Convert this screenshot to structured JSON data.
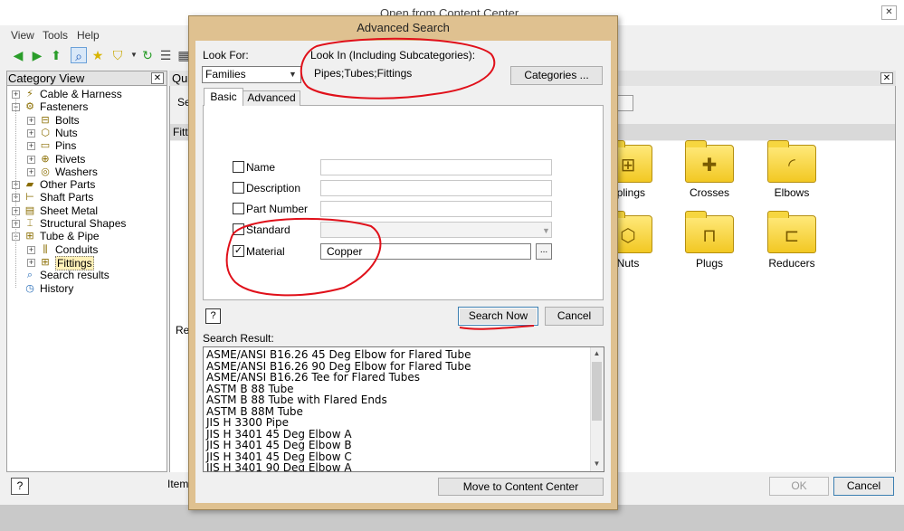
{
  "background_window": {
    "title": "Open from Content Center",
    "close_glyph": "✕",
    "menu": [
      "View",
      "Tools",
      "Help"
    ]
  },
  "category_view": {
    "title": "Category View",
    "close_glyph": "✕",
    "tree": [
      {
        "label": "Cable & Harness",
        "icon": "cable-icon",
        "expand": "+"
      },
      {
        "label": "Fasteners",
        "icon": "fastener-icon",
        "expand": "−"
      },
      {
        "label": "Bolts",
        "icon": "bolt-icon",
        "expand": "+"
      },
      {
        "label": "Nuts",
        "icon": "nut-icon",
        "expand": "+"
      },
      {
        "label": "Pins",
        "icon": "pin-icon",
        "expand": "+"
      },
      {
        "label": "Rivets",
        "icon": "rivet-icon",
        "expand": "+"
      },
      {
        "label": "Washers",
        "icon": "washer-icon",
        "expand": "+"
      },
      {
        "label": "Other Parts",
        "icon": "folder-icon",
        "expand": "+"
      },
      {
        "label": "Shaft Parts",
        "icon": "shaft-icon",
        "expand": "+"
      },
      {
        "label": "Sheet Metal",
        "icon": "sheet-metal-icon",
        "expand": "+"
      },
      {
        "label": "Structural Shapes",
        "icon": "beam-icon",
        "expand": "+"
      },
      {
        "label": "Tube & Pipe",
        "icon": "pipe-icon",
        "expand": "−"
      },
      {
        "label": "Conduits",
        "icon": "conduit-icon",
        "expand": "+"
      },
      {
        "label": "Fittings",
        "icon": "fitting-icon",
        "expand": "+"
      },
      {
        "label": "Search results",
        "icon": "search-icon",
        "expand": ""
      },
      {
        "label": "History",
        "icon": "history-icon",
        "expand": ""
      }
    ]
  },
  "quick_panel": {
    "title": "Qui",
    "search_prefix": "Se",
    "section_label": "Fitt",
    "close_glyph": "✕",
    "items": [
      {
        "label": "uplings",
        "icon": "coupling-icon"
      },
      {
        "label": "Crosses",
        "icon": "cross-icon"
      },
      {
        "label": "Elbows",
        "icon": "elbow-icon"
      },
      {
        "label": "Nuts",
        "icon": "nut-icon"
      },
      {
        "label": "Plugs",
        "icon": "plug-icon"
      },
      {
        "label": "Reducers",
        "icon": "reducer-icon"
      }
    ],
    "re_label": "Re"
  },
  "bottom": {
    "help": "?",
    "item_label": "Item",
    "ok": "OK",
    "cancel": "Cancel"
  },
  "dialog": {
    "title": "Advanced Search",
    "look_for_label": "Look For:",
    "look_for_value": "Families",
    "look_in_label": "Look In (Including Subcategories):",
    "look_in_value": "Pipes;Tubes;Fittings",
    "categories_button": "Categories ...",
    "tabs": [
      "Basic",
      "Advanced"
    ],
    "criteria": [
      {
        "label": "Name",
        "checked": false,
        "value": ""
      },
      {
        "label": "Description",
        "checked": false,
        "value": ""
      },
      {
        "label": "Part Number",
        "checked": false,
        "value": ""
      },
      {
        "label": "Standard",
        "checked": false,
        "value": ""
      },
      {
        "label": "Material",
        "checked": true,
        "value": "Copper"
      }
    ],
    "check_mark": "✓",
    "browse_button": "...",
    "help_button": "?",
    "search_button": "Search Now",
    "cancel_button": "Cancel",
    "result_label": "Search Result:",
    "results": [
      "ASME/ANSI B16.26 45 Deg Elbow for Flared Tube",
      "ASME/ANSI B16.26 90 Deg Elbow for Flared Tube",
      "ASME/ANSI B16.26 Tee for Flared Tubes",
      "ASTM B 88 Tube",
      "ASTM B 88 Tube with Flared Ends",
      "ASTM B 88M Tube",
      "JIS H 3300 Pipe",
      "JIS H 3401 45 Deg Elbow A",
      "JIS H 3401 45 Deg Elbow B",
      "JIS H 3401 45 Deg Elbow C",
      "JIS H 3401 90 Deg Elbow A"
    ],
    "move_button": "Move to Content Center"
  },
  "colors": {
    "dialog_frame": "#dfc190",
    "annotation": "#e0101a",
    "folder": "#f2c823"
  }
}
